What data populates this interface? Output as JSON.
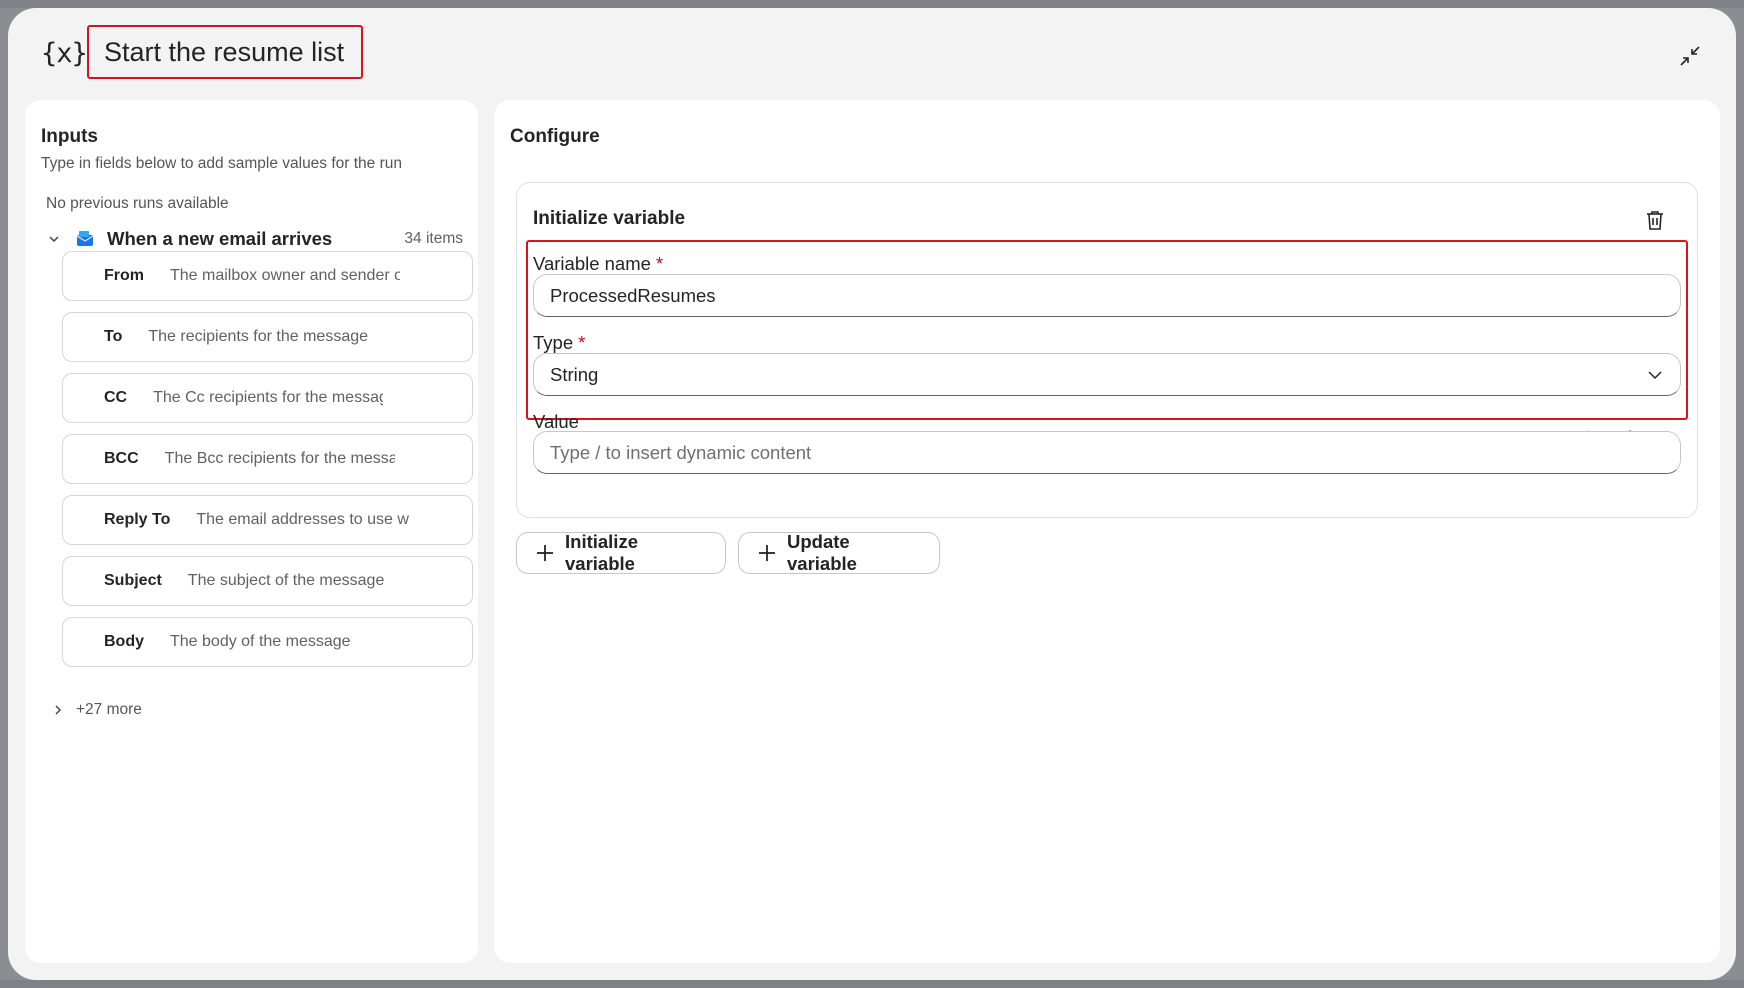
{
  "header": {
    "icon": "variable-icon",
    "icon_text": "{x}",
    "title": "Start the resume list",
    "collapse_icon": "collapse-icon"
  },
  "inputs": {
    "title": "Inputs",
    "subtitle": "Type in fields below to add sample values for the run",
    "no_runs": "No previous runs available",
    "trigger": {
      "label": "When a new email arrives",
      "count": "34 items",
      "icon": "outlook-mail-icon"
    },
    "fields": [
      {
        "label": "From",
        "description": "The mailbox owner and sender o"
      },
      {
        "label": "To",
        "description": "The recipients for the message"
      },
      {
        "label": "CC",
        "description": "The Cc recipients for the message"
      },
      {
        "label": "BCC",
        "description": "The Bcc recipients for the messag"
      },
      {
        "label": "Reply To",
        "description": "The email addresses to use w"
      },
      {
        "label": "Subject",
        "description": "The subject of the message"
      },
      {
        "label": "Body",
        "description": "The body of the message"
      }
    ],
    "more": "+27 more"
  },
  "configure": {
    "title": "Configure",
    "card_title": "Initialize variable",
    "variable_name_label": "Variable name",
    "variable_name_value": "ProcessedResumes",
    "type_label": "Type",
    "type_value": "String",
    "required_mark": "*",
    "value_label": "Value",
    "value_placeholder": "Type / to insert dynamic content",
    "value_icons": [
      "lightning-icon",
      "sparkle-icon",
      "code-icon"
    ],
    "buttons": {
      "init_variable": "Initialize variable",
      "update_variable": "Update variable"
    }
  },
  "colors": {
    "highlight": "#d8121f",
    "required": "#c50f1f"
  }
}
